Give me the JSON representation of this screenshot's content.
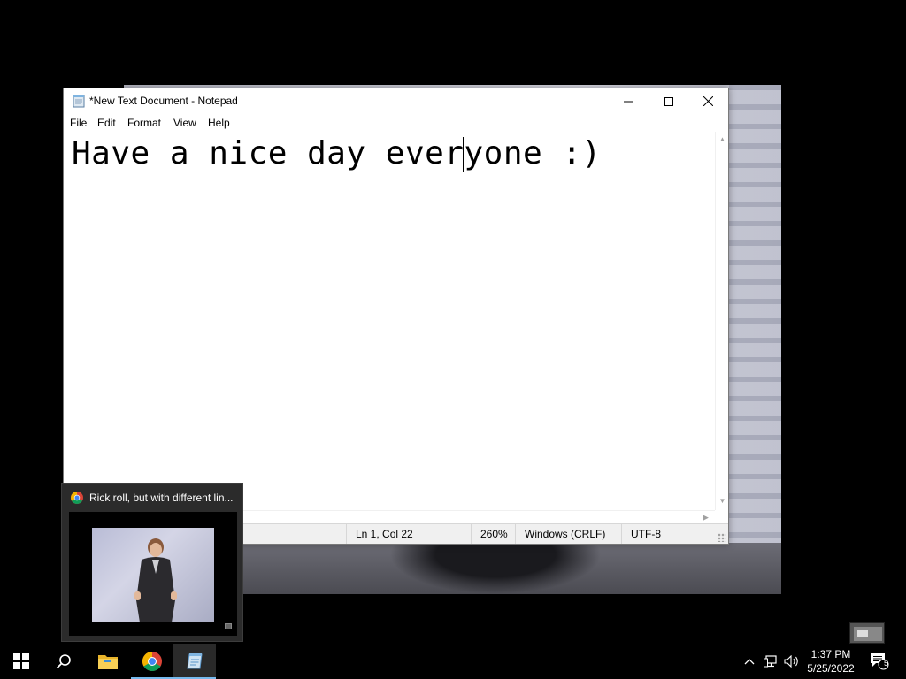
{
  "notepad": {
    "title": "*New Text Document - Notepad",
    "menu": [
      "File",
      "Edit",
      "Format",
      "View",
      "Help"
    ],
    "content": "Have a nice day everyone :)",
    "status": {
      "position": "Ln 1, Col 22",
      "zoom": "260%",
      "line_ending": "Windows (CRLF)",
      "encoding": "UTF-8"
    }
  },
  "preview": {
    "title": "Rick roll, but with different lin..."
  },
  "taskbar": {
    "apps": [
      "start-icon",
      "search-icon",
      "file-explorer-icon",
      "chrome-icon",
      "notepad-icon"
    ],
    "active_app": "notepad",
    "tray": [
      "show-hidden-icons-chevron",
      "network-icon",
      "volume-icon"
    ],
    "time": "1:37 PM",
    "date": "5/25/2022",
    "notification_count": "5"
  },
  "colors": {
    "taskbar": "#000000",
    "accent": "#76b9ed",
    "statusbar": "#f0f0f0"
  }
}
